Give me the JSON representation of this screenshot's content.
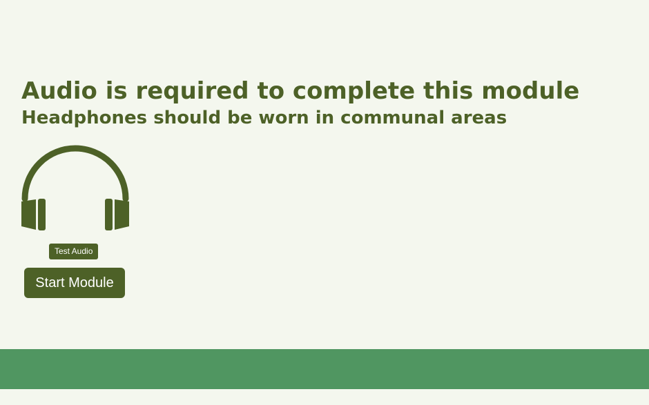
{
  "main": {
    "headline": "Audio is required to complete this module",
    "subheadline": "Headphones should be worn in communal areas",
    "icon": "headphones-icon",
    "test_audio_label": "Test Audio",
    "start_module_label": "Start Module"
  },
  "colors": {
    "background": "#f4f7ee",
    "primary": "#4d6127",
    "footer": "#509661",
    "button_text": "#ffffff"
  }
}
